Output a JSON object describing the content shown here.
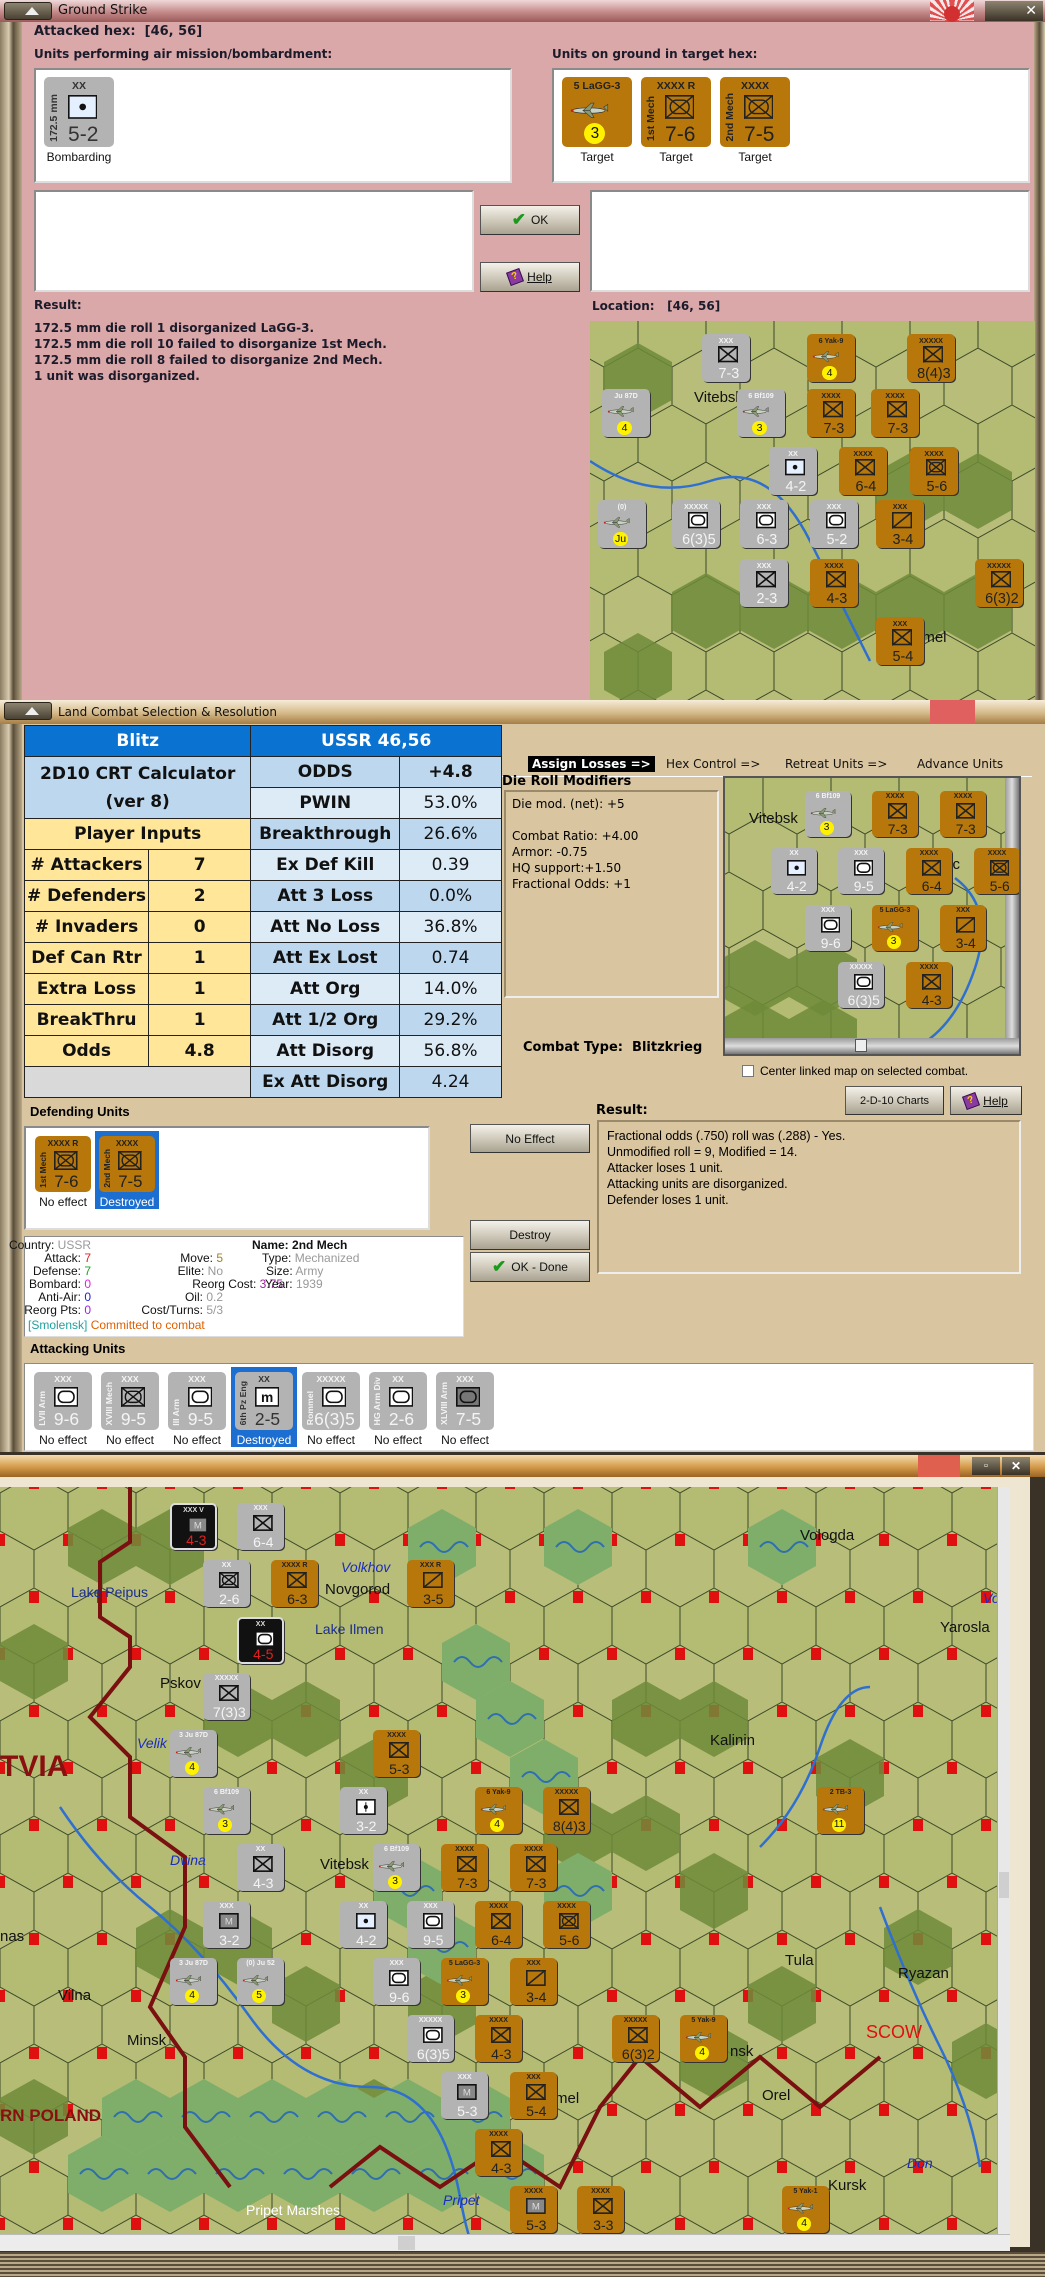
{
  "ground_strike": {
    "title": "Ground Strike",
    "attacked_hex_label": "Attacked hex:",
    "attacked_hex": "[46, 56]",
    "air_units_label": "Units performing air mission/bombardment:",
    "ground_units_label": "Units on ground in target hex:",
    "bombard_units": [
      {
        "type": "lite",
        "size": "XX",
        "name": "172.5 mm",
        "str": "5-2",
        "sym": "art",
        "status": "Bombarding"
      }
    ],
    "targets": [
      {
        "type": "brown",
        "size": "5  LaGG-3",
        "name": "",
        "str": "3",
        "sym": "air",
        "status": "Target"
      },
      {
        "type": "brown",
        "size": "XXXX  R",
        "name": "1st Mech",
        "str": "7-6",
        "sym": "mech",
        "status": "Target"
      },
      {
        "type": "brown",
        "size": "XXXX",
        "name": "2nd Mech",
        "str": "7-5",
        "sym": "mech",
        "status": "Target"
      }
    ],
    "ok_label": "OK",
    "help_label": "Help",
    "result_label": "Result:",
    "result_lines": [
      "172.5 mm die roll 1 disorganized LaGG-3.",
      "172.5 mm die roll 10 failed to disorganize 1st Mech.",
      "172.5 mm die roll 8 failed to disorganize 2nd Mech.",
      "1 unit was disorganized."
    ],
    "location_label": "Location:",
    "location": "[46, 56]",
    "minimap": {
      "cities": [
        "Vitebsk",
        "omel"
      ],
      "counters": [
        {
          "type": "gray",
          "size": "XXX",
          "name": "",
          "str": "7-3",
          "sym": "inf"
        },
        {
          "type": "brown",
          "size": "6 Yak-9",
          "name": "",
          "str": "4",
          "sym": "air"
        },
        {
          "type": "brown",
          "size": "XXXXX",
          "name": "",
          "str": "8(4)3",
          "sym": "inf"
        },
        {
          "type": "gray",
          "size": "Ju 87D",
          "name": "",
          "str": "4",
          "sym": "air"
        },
        {
          "type": "gray",
          "size": "6 Bf109",
          "name": "",
          "str": "3",
          "sym": "air"
        },
        {
          "type": "brown",
          "size": "XXXX",
          "name": "",
          "str": "7-3",
          "sym": "inf"
        },
        {
          "type": "brown",
          "size": "XXXX",
          "name": "",
          "str": "7-3",
          "sym": "inf"
        },
        {
          "type": "gray",
          "size": "XX",
          "name": "",
          "str": "4-2",
          "sym": "art"
        },
        {
          "type": "brown",
          "size": "XXXX",
          "name": "",
          "str": "6-4",
          "sym": "inf"
        },
        {
          "type": "brown",
          "size": "XXXX",
          "name": "",
          "str": "5-6",
          "sym": "mech"
        },
        {
          "type": "gray",
          "size": "(0)",
          "name": "",
          "str": "Ju 52",
          "sym": "air"
        },
        {
          "type": "gray",
          "size": "XXXXX",
          "name": "",
          "str": "6(3)5",
          "sym": "arm"
        },
        {
          "type": "gray",
          "size": "XXX",
          "name": "",
          "str": "6-3",
          "sym": "arm"
        },
        {
          "type": "gray",
          "size": "XXX",
          "name": "",
          "str": "5-2",
          "sym": "arm"
        },
        {
          "type": "brown",
          "size": "XXX",
          "name": "",
          "str": "3-4",
          "sym": "cav"
        },
        {
          "type": "gray",
          "size": "XXX",
          "name": "",
          "str": "2-3",
          "sym": "inf"
        },
        {
          "type": "brown",
          "size": "XXXX",
          "name": "",
          "str": "4-3",
          "sym": "inf"
        },
        {
          "type": "brown",
          "size": "XXXXX",
          "name": "",
          "str": "6(3)2",
          "sym": "inf"
        },
        {
          "type": "brown",
          "size": "XXX",
          "name": "",
          "str": "5-4",
          "sym": "inf"
        }
      ]
    }
  },
  "land_combat": {
    "title": "Land Combat Selection & Resolution",
    "calc": {
      "left_header": "Blitz",
      "right_header": "USSR 46,56",
      "calc_title_1": "2D10 CRT Calculator",
      "calc_title_2": "(ver 8)",
      "inputs_header": "Player Inputs",
      "inputs": [
        {
          "label": "# Attackers",
          "value": "7"
        },
        {
          "label": "# Defenders",
          "value": "2"
        },
        {
          "label": "# Invaders",
          "value": "0"
        },
        {
          "label": "Def Can Rtr",
          "value": "1"
        },
        {
          "label": "Extra Loss",
          "value": "1"
        },
        {
          "label": "BreakThru",
          "value": "1"
        },
        {
          "label": "Odds",
          "value": "4.8"
        }
      ],
      "outputs": [
        {
          "label": "ODDS",
          "value": "+4.8"
        },
        {
          "label": "PWIN",
          "value": "53.0%"
        },
        {
          "label": "Breakthrough",
          "value": "26.6%"
        },
        {
          "label": "Ex Def Kill",
          "value": "0.39"
        },
        {
          "label": "Att 3 Loss",
          "value": "0.0%"
        },
        {
          "label": "Att No Loss",
          "value": "36.8%"
        },
        {
          "label": "Att Ex Lost",
          "value": "0.74"
        },
        {
          "label": "Att Org",
          "value": "14.0%"
        },
        {
          "label": "Att 1/2 Org",
          "value": "29.2%"
        },
        {
          "label": "Att Disorg",
          "value": "56.8%"
        },
        {
          "label": "Ex Att Disorg",
          "value": "4.24"
        }
      ]
    },
    "tabs": [
      "Assign Losses =>",
      "Hex Control =>",
      "Retreat Units =>",
      "Advance Units"
    ],
    "die_mod_title": "Die Roll Modifiers",
    "die_mods": [
      "Die mod. (net): +5",
      "",
      "Combat Ratio: +4.00",
      "Armor: -0.75",
      "HQ support:+1.50",
      "Fractional Odds: +1"
    ],
    "combat_type_label": "Combat Type:",
    "combat_type": "Blitzkrieg",
    "center_checkbox_label": "Center linked map on selected combat.",
    "center_checkbox_checked": false,
    "charts_button": "2-D-10 Charts",
    "help_button": "Help",
    "result_label": "Result:",
    "result_lines": [
      "Fractional odds (.750) roll was (.288)  - Yes.",
      "Unmodified roll = 9, Modified = 14.",
      "Attacker loses 1 unit.",
      "Attacking units are disorganized.",
      "Defender loses 1 unit."
    ],
    "defending_label": "Defending Units",
    "defenders": [
      {
        "type": "brown",
        "size": "XXXX R",
        "name": "1st Mech",
        "str": "7-6",
        "sym": "mech",
        "status": "No effect",
        "selected": false
      },
      {
        "type": "brown",
        "size": "XXXX",
        "name": "2nd Mech",
        "str": "7-5",
        "sym": "mech",
        "status": "Destroyed",
        "selected": true
      }
    ],
    "no_effect_button": "No Effect",
    "destroy_button": "Destroy",
    "ok_done_button": "OK - Done",
    "unit_info": {
      "country_label": "Country:",
      "country": "USSR",
      "attack_label": "Attack:",
      "attack": "7",
      "defense_label": "Defense:",
      "defense": "7",
      "bombard_label": "Bombard:",
      "bombard": "0",
      "antiair_label": "Anti-Air:",
      "antiair": "0",
      "reorgpts_label": "Reorg Pts:",
      "reorgpts": "0",
      "move_label": "Move:",
      "move": "5",
      "elite_label": "Elite:",
      "elite": "No",
      "reorgcost_label": "Reorg Cost:",
      "reorgcost": "3.75",
      "oil_label": "Oil:",
      "oil": "0.2",
      "costturns_label": "Cost/Turns:",
      "costturns": "5/3",
      "name_label": "Name:",
      "name": "2nd Mech",
      "type_label": "Type:",
      "type": "Mechanized",
      "size_label": "Size:",
      "size": "Army",
      "year_label": "Year:",
      "year": "1939",
      "location": "[Smolensk]",
      "status": "Committed to combat"
    },
    "attacking_label": "Attacking Units",
    "attackers": [
      {
        "type": "gray",
        "size": "XXX",
        "name": "LVII Arm",
        "str": "9-6",
        "sym": "arm",
        "status": "No effect",
        "selected": false
      },
      {
        "type": "gray",
        "size": "XXX",
        "name": "XVIII Mech",
        "str": "9-5",
        "sym": "mech",
        "status": "No effect",
        "selected": false
      },
      {
        "type": "gray",
        "size": "XXX",
        "name": "III Arm",
        "str": "9-5",
        "sym": "arm",
        "status": "No effect",
        "selected": false
      },
      {
        "type": "lite",
        "size": "XX",
        "name": "6th Pz Eng",
        "str": "2-5",
        "sym": "eng",
        "status": "Destroyed",
        "selected": true
      },
      {
        "type": "gray",
        "size": "XXXXX",
        "name": "Rommel",
        "str": "6(3)5",
        "sym": "arm",
        "status": "No effect",
        "selected": false
      },
      {
        "type": "gray",
        "size": "XX",
        "name": "HG Arm Div",
        "str": "2-6",
        "sym": "arm",
        "status": "No effect",
        "selected": false
      },
      {
        "type": "gray",
        "size": "XXX",
        "name": "XLVIII Arm",
        "str": "7-5",
        "sym": "armdk",
        "status": "No effect",
        "selected": false
      }
    ],
    "minimap": {
      "cities": [
        "Vitebsk",
        "mc"
      ],
      "counters": [
        {
          "type": "gray",
          "size": "6 Bf109",
          "name": "",
          "str": "3",
          "sym": "air"
        },
        {
          "type": "brown",
          "size": "XXXX",
          "name": "",
          "str": "7-3",
          "sym": "inf"
        },
        {
          "type": "brown",
          "size": "XXXX",
          "name": "",
          "str": "7-3",
          "sym": "inf"
        },
        {
          "type": "gray",
          "size": "XX",
          "name": "",
          "str": "4-2",
          "sym": "art"
        },
        {
          "type": "gray",
          "size": "XXX",
          "name": "",
          "str": "9-5",
          "sym": "arm"
        },
        {
          "type": "brown",
          "size": "XXXX",
          "name": "",
          "str": "6-4",
          "sym": "inf"
        },
        {
          "type": "brown",
          "size": "XXXX",
          "name": "",
          "str": "5-6",
          "sym": "mech"
        },
        {
          "type": "gray",
          "size": "XXX",
          "name": "",
          "str": "9-6",
          "sym": "arm"
        },
        {
          "type": "brown",
          "size": "5 LaGG-3",
          "name": "",
          "str": "3",
          "sym": "air"
        },
        {
          "type": "brown",
          "size": "XXX",
          "name": "",
          "str": "3-4",
          "sym": "cav"
        },
        {
          "type": "gray",
          "size": "XXXXX",
          "name": "",
          "str": "6(3)5",
          "sym": "arm"
        },
        {
          "type": "brown",
          "size": "XXXX",
          "name": "",
          "str": "4-3",
          "sym": "inf"
        }
      ]
    }
  },
  "map": {
    "cities": [
      {
        "name": "Vologda",
        "kind": "city"
      },
      {
        "name": "Novgorod",
        "kind": "city"
      },
      {
        "name": "Lake Peipus",
        "kind": "lake"
      },
      {
        "name": "Volkhov",
        "kind": "water"
      },
      {
        "name": "Lake Ilmen",
        "kind": "lake"
      },
      {
        "name": "Yarosla",
        "kind": "city"
      },
      {
        "name": "Pskov",
        "kind": "city"
      },
      {
        "name": "Kalinin",
        "kind": "city"
      },
      {
        "name": "TVIA",
        "kind": "region"
      },
      {
        "name": "Velik",
        "kind": "water"
      },
      {
        "name": "Dvina",
        "kind": "water"
      },
      {
        "name": "Vitebsk",
        "kind": "city"
      },
      {
        "name": "Vilna",
        "kind": "city"
      },
      {
        "name": "Minsk",
        "kind": "city"
      },
      {
        "name": "Tula",
        "kind": "city"
      },
      {
        "name": "Ryazan",
        "kind": "city"
      },
      {
        "name": "Orel",
        "kind": "city"
      },
      {
        "name": "Kursk",
        "kind": "city"
      },
      {
        "name": "Pripet Marshes",
        "kind": "white"
      },
      {
        "name": "Pripet",
        "kind": "water"
      },
      {
        "name": "Don",
        "kind": "water"
      },
      {
        "name": "RN POLAND",
        "kind": "regionsm"
      },
      {
        "name": "mel",
        "kind": "city"
      },
      {
        "name": "nsk",
        "kind": "city"
      },
      {
        "name": "SCOW",
        "kind": "red"
      },
      {
        "name": "nas",
        "kind": "city"
      },
      {
        "name": "Vo",
        "kind": "water"
      }
    ],
    "counters": [
      {
        "type": "black",
        "size": "XXX V",
        "name": "",
        "str": "4-3",
        "sym": "mtn"
      },
      {
        "type": "gray",
        "size": "XXX",
        "name": "",
        "str": "6-4",
        "sym": "inf"
      },
      {
        "type": "gray",
        "size": "XX",
        "name": "",
        "str": "2-6",
        "sym": "mech"
      },
      {
        "type": "brown",
        "size": "XXXX R",
        "name": "",
        "str": "6-3",
        "sym": "inf"
      },
      {
        "type": "brown",
        "size": "XXX R",
        "name": "",
        "str": "3-5",
        "sym": "cav"
      },
      {
        "type": "black",
        "size": "XX",
        "name": "",
        "str": "4-5",
        "sym": "arm"
      },
      {
        "type": "gray",
        "size": "XXXXX",
        "name": "",
        "str": "7(3)3",
        "sym": "inf"
      },
      {
        "type": "gray",
        "size": "3 Ju 87D",
        "name": "",
        "str": "4",
        "sym": "air"
      },
      {
        "type": "brown",
        "size": "XXXX",
        "name": "",
        "str": "5-3",
        "sym": "inf"
      },
      {
        "type": "gray",
        "size": "6 Bf109",
        "name": "",
        "str": "3",
        "sym": "air"
      },
      {
        "type": "gray",
        "size": "XX",
        "name": "",
        "str": "3-2",
        "sym": "para"
      },
      {
        "type": "brown",
        "size": "6 Yak-9",
        "name": "",
        "str": "4",
        "sym": "air"
      },
      {
        "type": "brown",
        "size": "XXXXX",
        "name": "",
        "str": "8(4)3",
        "sym": "inf"
      },
      {
        "type": "brown",
        "size": "2 TB-3",
        "name": "",
        "str": "11",
        "sym": "air"
      },
      {
        "type": "gray",
        "size": "XX",
        "name": "",
        "str": "4-3",
        "sym": "inf"
      },
      {
        "type": "gray",
        "size": "6 Bf109",
        "name": "",
        "str": "3",
        "sym": "air"
      },
      {
        "type": "brown",
        "size": "XXXX",
        "name": "",
        "str": "7-3",
        "sym": "inf"
      },
      {
        "type": "brown",
        "size": "XXXX",
        "name": "",
        "str": "7-3",
        "sym": "inf"
      },
      {
        "type": "gray",
        "size": "XXX",
        "name": "",
        "str": "3-2",
        "sym": "mtn"
      },
      {
        "type": "gray",
        "size": "XX",
        "name": "",
        "str": "4-2",
        "sym": "art"
      },
      {
        "type": "gray",
        "size": "XXX",
        "name": "",
        "str": "9-5",
        "sym": "arm"
      },
      {
        "type": "brown",
        "size": "XXXX",
        "name": "",
        "str": "6-4",
        "sym": "inf"
      },
      {
        "type": "brown",
        "size": "XXXX",
        "name": "",
        "str": "5-6",
        "sym": "mech"
      },
      {
        "type": "gray",
        "size": "3 Ju 87D",
        "name": "",
        "str": "4",
        "sym": "air"
      },
      {
        "type": "gray",
        "size": "(0) Ju 52",
        "name": "",
        "str": "5",
        "sym": "air"
      },
      {
        "type": "gray",
        "size": "XXX",
        "name": "",
        "str": "9-6",
        "sym": "arm"
      },
      {
        "type": "brown",
        "size": "5 LaGG-3",
        "name": "",
        "str": "3",
        "sym": "air"
      },
      {
        "type": "brown",
        "size": "XXX",
        "name": "",
        "str": "3-4",
        "sym": "cav"
      },
      {
        "type": "gray",
        "size": "XXXXX",
        "name": "",
        "str": "6(3)5",
        "sym": "arm"
      },
      {
        "type": "brown",
        "size": "XXXX",
        "name": "",
        "str": "4-3",
        "sym": "inf"
      },
      {
        "type": "brown",
        "size": "XXXXX",
        "name": "",
        "str": "6(3)2",
        "sym": "inf"
      },
      {
        "type": "brown",
        "size": "5 Yak-9",
        "name": "",
        "str": "4",
        "sym": "air"
      },
      {
        "type": "gray",
        "size": "XXX",
        "name": "",
        "str": "5-3",
        "sym": "mtn"
      },
      {
        "type": "brown",
        "size": "XXX",
        "name": "",
        "str": "5-4",
        "sym": "inf"
      },
      {
        "type": "brown",
        "size": "XXXX",
        "name": "",
        "str": "4-3",
        "sym": "inf"
      },
      {
        "type": "brown",
        "size": "XXXX",
        "name": "",
        "str": "5-3",
        "sym": "mtn"
      },
      {
        "type": "brown",
        "size": "XXXX",
        "name": "",
        "str": "3-3",
        "sym": "inf"
      },
      {
        "type": "brown",
        "size": "5 Yak-1",
        "name": "",
        "str": "4",
        "sym": "air"
      }
    ]
  },
  "colors": {
    "gs_bg": "#dba8aa",
    "lc_bg": "#d9c59f",
    "header_blue": "#0a72d0",
    "counter_brown": "#b7770a",
    "counter_gray": "#b3b3b3",
    "selected": "#1c6fd0"
  }
}
